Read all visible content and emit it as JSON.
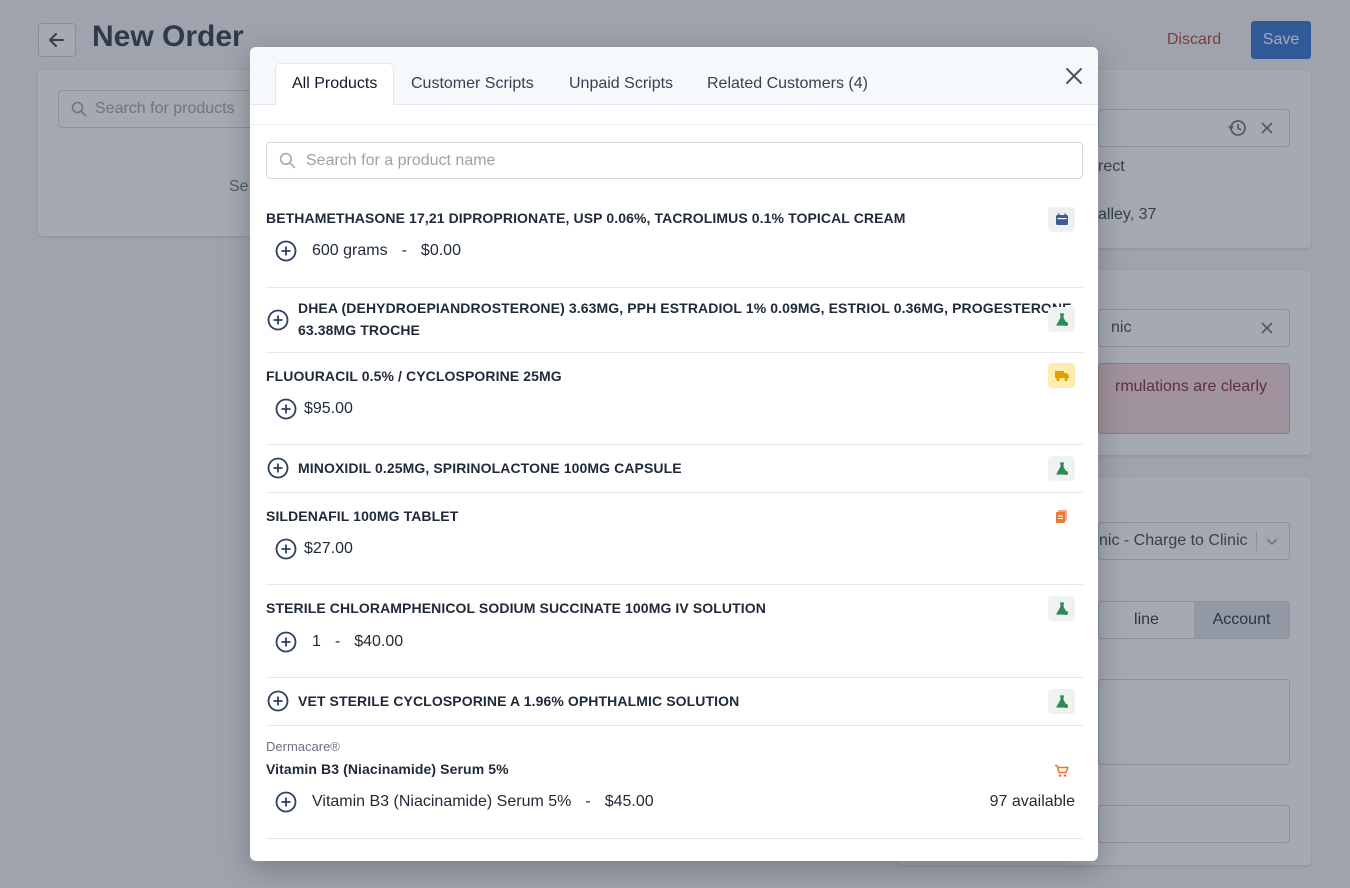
{
  "page": {
    "title": "New Order",
    "discard_label": "Discard",
    "save_label": "Save",
    "left_search_placeholder": "Search for products",
    "left_empty_text": "Se",
    "right_panel": {
      "prescriber_text_1": "rect",
      "prescriber_text_2": "alley, 37",
      "clinic_value": "nic",
      "alert_text": "rmulations are clearly",
      "billing_select": "nic - Charge to Clinic",
      "payment_options": [
        "line",
        "Account"
      ]
    }
  },
  "modal": {
    "tabs": [
      {
        "label": "All Products"
      },
      {
        "label": "Customer Scripts"
      },
      {
        "label": "Unpaid Scripts"
      },
      {
        "label": "Related Customers (4)"
      }
    ],
    "search_placeholder": "Search for a product name",
    "items": [
      {
        "title": "BETHAMETHASONE 17,21 DIPROPRIONATE, USP 0.06%, TACROLIMUS 0.1% TOPICAL CREAM",
        "size": "600 grams",
        "sep": "-",
        "price": "$0.00",
        "badge_icon": "calendar-icon"
      },
      {
        "title_line1": "DHEA (DEHYDROEPIANDROSTERONE) 3.63MG, PPH ESTRADIOL 1% 0.09MG, ESTRIOL 0.36MG, PROGESTERONE",
        "title_line2": "63.38MG TROCHE",
        "badge_icon": "flask-icon"
      },
      {
        "title": "FLUOURACIL 0.5% / CYCLOSPORINE 25MG",
        "price": "$95.00",
        "badge_icon": "truck-icon"
      },
      {
        "title": "MINOXIDIL 0.25MG, SPIRINOLACTONE 100MG CAPSULE",
        "badge_icon": "flask-icon"
      },
      {
        "title": "SILDENAFIL 100MG TABLET",
        "price": "$27.00",
        "badge_icon": "document-icon"
      },
      {
        "title": "STERILE CHLORAMPHENICOL SODIUM SUCCINATE 100MG IV SOLUTION",
        "size": "1",
        "sep": "-",
        "price": "$40.00",
        "badge_icon": "flask-icon"
      },
      {
        "title": "VET STERILE CYCLOSPORINE A 1.96% OPHTHALMIC SOLUTION",
        "badge_icon": "flask-icon"
      },
      {
        "brand": "Dermacare®",
        "title": "Vitamin B3 (Niacinamide) Serum 5%",
        "size": "Vitamin B3 (Niacinamide) Serum 5%",
        "sep": "-",
        "price": "$45.00",
        "availability": "97 available",
        "badge_icon": "cart-icon"
      }
    ]
  },
  "colors": {
    "primary": "#2f6fd1",
    "danger": "#c0392b",
    "navy_icon": "#2c3e63",
    "green_icon": "#2e8b57",
    "orange_icon": "#e8792f",
    "yellow_badge": "#fdeeb0"
  }
}
